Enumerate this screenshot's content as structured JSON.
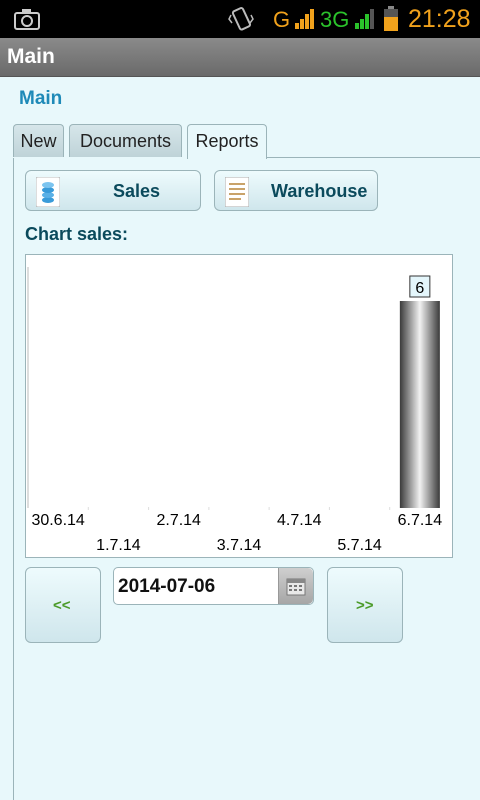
{
  "status_bar": {
    "time": "21:28",
    "network_1": "G",
    "network_2": "3G",
    "icons": [
      "camera-icon",
      "vibrate-icon",
      "signal-icon",
      "signal-icon",
      "battery-icon"
    ],
    "colors": {
      "time": "#f1a21c",
      "network_1": "#f1a21c",
      "network_2": "#2bc22b"
    }
  },
  "title_bar": {
    "title": "Main"
  },
  "page": {
    "heading": "Main"
  },
  "tabs": [
    {
      "label": "New",
      "active": false
    },
    {
      "label": "Documents",
      "active": false
    },
    {
      "label": "Reports",
      "active": true
    }
  ],
  "report_buttons": {
    "sales": {
      "label": "Sales",
      "icon": "coins-icon"
    },
    "warehouse": {
      "label": "Warehouse",
      "icon": "document-icon"
    }
  },
  "chart": {
    "label": "Chart sales:"
  },
  "chart_data": {
    "type": "bar",
    "categories": [
      "30.6.14",
      "1.7.14",
      "2.7.14",
      "3.7.14",
      "4.7.14",
      "5.7.14",
      "6.7.14"
    ],
    "values": [
      0,
      0,
      0,
      0,
      0,
      0,
      6
    ],
    "data_labels": [
      "",
      "",
      "",
      "",
      "",
      "",
      "6"
    ],
    "ylim": [
      0,
      6
    ],
    "grid": false,
    "title": "",
    "xlabel": "",
    "ylabel": ""
  },
  "date_nav": {
    "prev_label": "<<",
    "next_label": ">>",
    "date_value": "2014-07-06",
    "calendar_icon": "calendar-icon"
  }
}
